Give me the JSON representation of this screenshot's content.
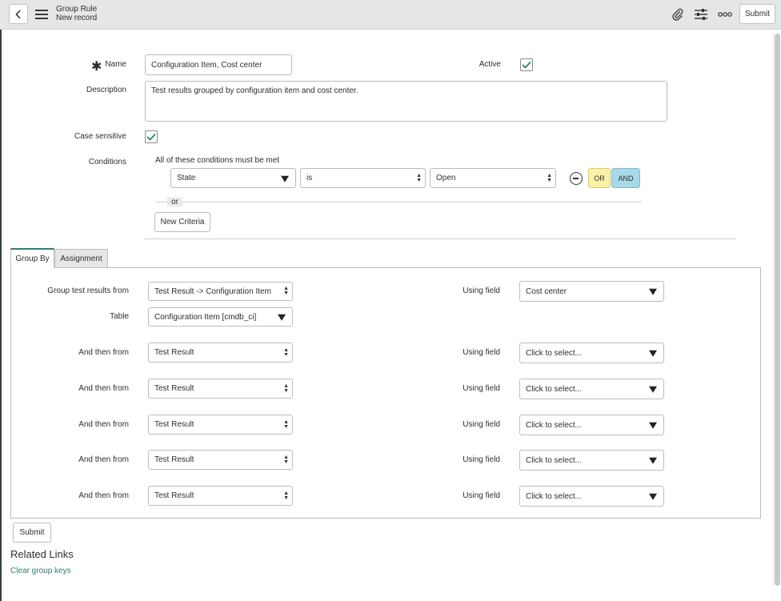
{
  "header": {
    "title": "Group Rule",
    "subtitle": "New record",
    "submit_label": "Submit",
    "icons": [
      "back-icon",
      "menu-icon",
      "paperclip-icon",
      "sliders-icon",
      "more-icon"
    ]
  },
  "form": {
    "name_label": "Name",
    "name_value": "Configuration Item,  Cost center",
    "active_label": "Active",
    "active_checked": true,
    "description_label": "Description",
    "description_value": "Test results grouped by configuration item and cost center.",
    "case_sensitive_label": "Case sensitive",
    "case_sensitive_checked": true,
    "conditions_label": "Conditions",
    "conditions_heading": "All of these conditions must be met",
    "condition": {
      "field": "State",
      "operator": "is",
      "value": "Open"
    },
    "or_button": "OR",
    "and_button": "AND",
    "or_divider": "or",
    "new_criteria_button": "New Criteria"
  },
  "tabs": [
    {
      "label": "Group By",
      "active": true
    },
    {
      "label": "Assignment",
      "active": false
    }
  ],
  "group_by": {
    "group_from_label": "Group test results from",
    "group_from_value": "Test Result -> Configuration Item",
    "using_field_label": "Using field",
    "using_field_value": "Cost center",
    "table_label": "Table",
    "table_value": "Configuration Item [cmdb_ci]",
    "rows": [
      {
        "label": "And then from",
        "from": "Test Result",
        "using_label": "Using field",
        "using": "Click to select..."
      },
      {
        "label": "And then from",
        "from": "Test Result",
        "using_label": "Using field",
        "using": "Click to select..."
      },
      {
        "label": "And then from",
        "from": "Test Result",
        "using_label": "Using field",
        "using": "Click to select..."
      },
      {
        "label": "And then from",
        "from": "Test Result",
        "using_label": "Using field",
        "using": "Click to select..."
      },
      {
        "label": "And then from",
        "from": "Test Result",
        "using_label": "Using field",
        "using": "Click to select..."
      }
    ]
  },
  "footer": {
    "submit_label": "Submit",
    "related_links_heading": "Related Links",
    "clear_group_keys_link": "Clear group keys"
  },
  "colors": {
    "header_bg": "#e4e6e7",
    "accent": "#2e7d6e",
    "or_bg": "#fcf0a8",
    "and_bg": "#a9d9e8",
    "link": "#2e7d6e"
  }
}
